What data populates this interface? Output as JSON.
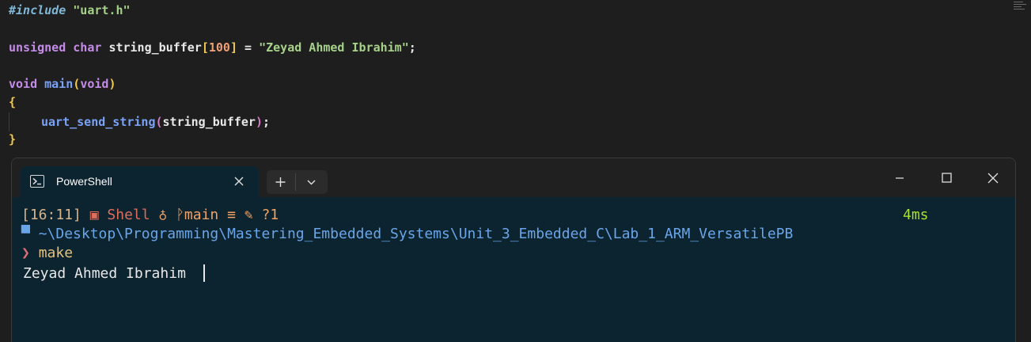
{
  "editor": {
    "include_directive": "#include",
    "include_file": "\"uart.h\"",
    "decl_type": "unsigned char",
    "decl_name": "string_buffer",
    "decl_bracket_open": "[",
    "decl_size": "100",
    "decl_bracket_close": "]",
    "decl_assign": " = ",
    "decl_value": "\"Zeyad Ahmed Ibrahim\"",
    "decl_semicolon": ";",
    "main_return_type": "void",
    "main_name": "main",
    "main_paren_open": "(",
    "main_param": "void",
    "main_paren_close": ")",
    "brace_open": "{",
    "call_name": "uart_send_string",
    "call_paren_open": "(",
    "call_arg": "string_buffer",
    "call_paren_close": ")",
    "call_semicolon": ";",
    "brace_close": "}"
  },
  "terminal": {
    "tab_title": "PowerShell",
    "icons": {
      "tab": "powershell-icon",
      "close_tab": "close-icon",
      "new_tab": "plus-icon",
      "dropdown": "chevron-down-icon",
      "minimize": "minimize-icon",
      "maximize": "maximize-icon",
      "close_window": "close-icon",
      "shell": "shell-icon",
      "git": "git-branch-icon",
      "status": "equals-icon",
      "modified": "edit-icon",
      "folder": "folder-icon",
      "prompt": "prompt-chevron-icon"
    },
    "prompt": {
      "time": "[16:11]",
      "shell_name": "Shell",
      "branch": "main",
      "status_symbol": "≡",
      "untracked": "?1",
      "duration": "4ms",
      "path": "~\\Desktop\\Programming\\Mastering_Embedded_Systems\\Unit_3_Embedded_C\\Lab_1_ARM_VersatilePB",
      "prompt_symbol": "❯",
      "command": "make"
    },
    "output": "Zeyad Ahmed Ibrahim"
  },
  "colors": {
    "editor_bg": "#1e1e1e",
    "terminal_bg": "#0c2430",
    "titlebar_bg": "#202020"
  }
}
